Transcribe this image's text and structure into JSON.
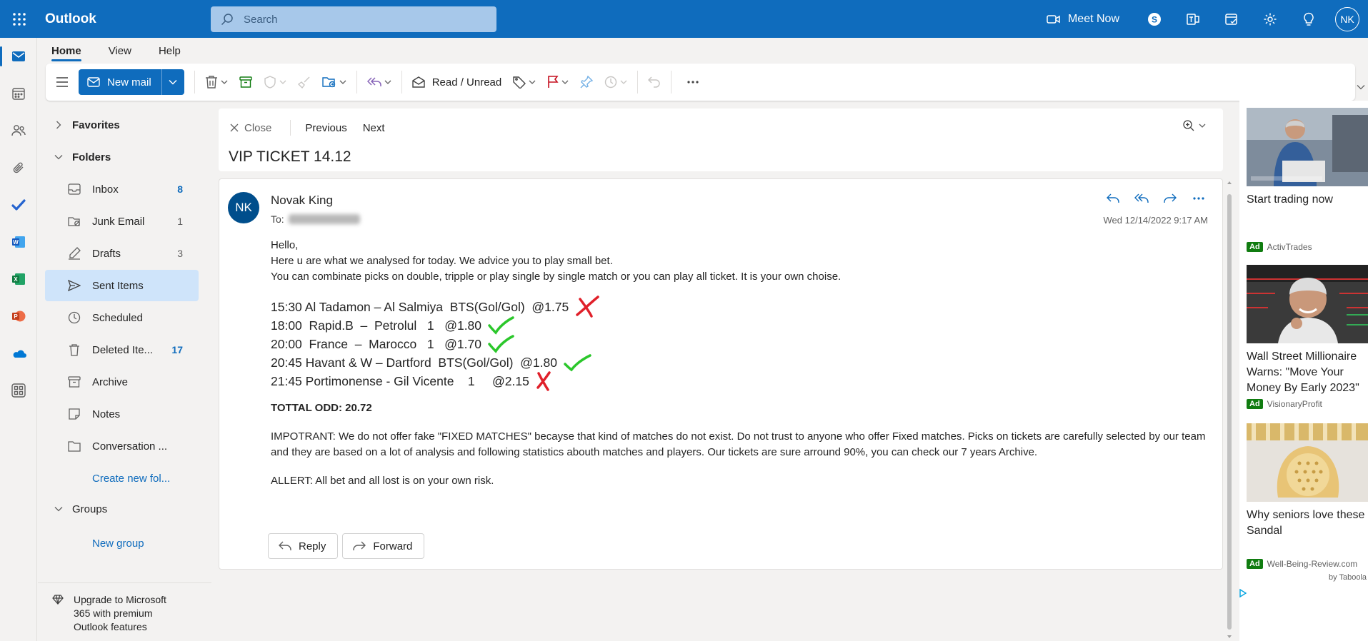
{
  "app": {
    "name": "Outlook"
  },
  "search": {
    "placeholder": "Search"
  },
  "topbar": {
    "meet_now": "Meet Now",
    "avatar": "NK"
  },
  "tabs": [
    {
      "label": "Home",
      "active": true
    },
    {
      "label": "View",
      "active": false
    },
    {
      "label": "Help",
      "active": false
    }
  ],
  "ribbon": {
    "new_mail": "New mail",
    "read_unread": "Read / Unread"
  },
  "folders": {
    "favorites": "Favorites",
    "folders": "Folders",
    "items": [
      {
        "label": "Inbox",
        "count": "8",
        "icon": "inbox-icon"
      },
      {
        "label": "Junk Email",
        "count": "1",
        "icon": "junk-icon"
      },
      {
        "label": "Drafts",
        "count": "3",
        "icon": "drafts-icon"
      },
      {
        "label": "Sent Items",
        "count": "",
        "icon": "sent-icon"
      },
      {
        "label": "Scheduled",
        "count": "",
        "icon": "clock-icon"
      },
      {
        "label": "Deleted Ite...",
        "count": "17",
        "icon": "trash-icon"
      },
      {
        "label": "Archive",
        "count": "",
        "icon": "archive-icon"
      },
      {
        "label": "Notes",
        "count": "",
        "icon": "notes-icon"
      },
      {
        "label": "Conversation ...",
        "count": "",
        "icon": "folder-icon"
      }
    ],
    "create_new": "Create new fol...",
    "groups": "Groups",
    "new_group": "New group",
    "upgrade": "Upgrade to Microsoft 365 with premium Outlook features"
  },
  "reading": {
    "close": "Close",
    "previous": "Previous",
    "next": "Next",
    "subject": "VIP TICKET 14.12"
  },
  "message": {
    "avatar": "NK",
    "sender": "Novak King",
    "to_label": "To:",
    "date": "Wed 12/14/2022 9:17 AM",
    "greeting": "Hello,",
    "line1": "Here u are what we analysed for today. We advice you to play small bet.",
    "line2": "You can combinate picks on double, tripple or play single by single match or you can play all ticket. It is your own choise.",
    "picks": [
      {
        "text": "15:30 Al Tadamon – Al Salmiya  BTS(Gol/Gol)  @1.75",
        "result": "lost"
      },
      {
        "text": "18:00  Rapid.B  –  Petrolul   1   @1.80",
        "result": "won"
      },
      {
        "text": "20:00  France  –  Marocco   1   @1.70",
        "result": "won"
      },
      {
        "text": "20:45 Havant & W – Dartford  BTS(Gol/Gol)  @1.80",
        "result": "won"
      },
      {
        "text": "21:45 Portimonense - Gil Vicente    1     @2.15",
        "result": "lost"
      }
    ],
    "total_odd": "TOTTAL ODD: 20.72",
    "important": "IMPOTRANT: We do not offer fake \"FIXED MATCHES\" becayse that kind of matches do not exist. Do not trust to anyone who offer Fixed matches. Picks on tickets are carefully selected by our team and they are based on a lot of analysis and following statistics abouth matches and players. Our tickets are sure arround 90%, you can check our 7 years Archive.",
    "allert": "ALLERT: All bet and all lost is on your own risk.",
    "reply": "Reply",
    "forward": "Forward"
  },
  "ads": [
    {
      "title": "Start trading now",
      "badge": "Ad",
      "source": "ActivTrades"
    },
    {
      "title": "Wall Street Millionaire Warns: \"Move Your Money By Early 2023\"",
      "badge": "Ad",
      "source": "VisionaryProfit"
    },
    {
      "title": "Why seniors love these Sandal",
      "badge": "Ad",
      "source": "Well-Being-Review.com"
    }
  ],
  "taboola": "by Taboola",
  "colors": {
    "brand": "#0f6cbd",
    "won": "#2bc72b",
    "lost": "#e0202a"
  }
}
